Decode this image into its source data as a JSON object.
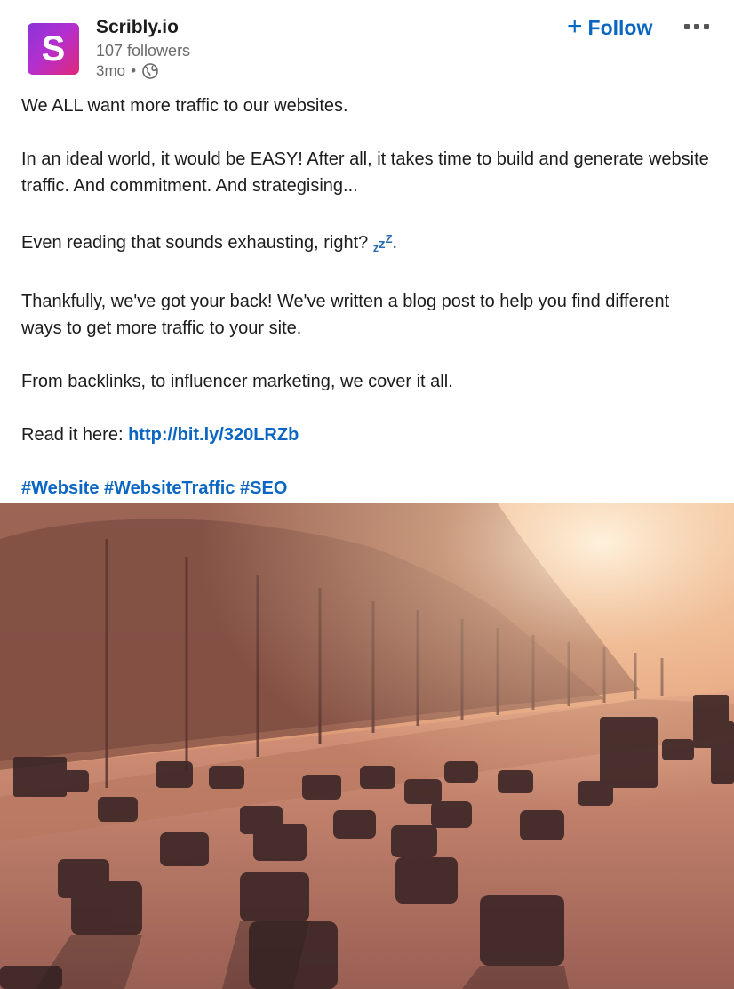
{
  "author": {
    "logo_letter": "S",
    "name": "Scribly.io",
    "followers": "107 followers",
    "time": "3mo",
    "separator": "•",
    "visibility_icon": "globe-icon"
  },
  "actions": {
    "follow_plus": "+",
    "follow_label": "Follow",
    "more_icon": "ellipsis-icon"
  },
  "post": {
    "p1": "We ALL want more traffic to our websites.",
    "p2": "In an ideal world, it would be EASY! After all, it takes time to build and generate website traffic. And commitment. And strategising...",
    "p3_text": "Even reading that sounds exhausting, right? ",
    "p3_emoji_small": "z",
    "p3_emoji_mid": "z",
    "p3_emoji_big": "Z",
    "p3_end": ".",
    "p4": "Thankfully, we've got your back! We've written a blog post to help you find different ways to get more traffic to your site.",
    "p5": "From backlinks, to influencer marketing, we cover it all.",
    "p6_prefix": "Read it here: ",
    "link": "http://bit.ly/320LRZb",
    "hashtags": [
      "#Website",
      "#WebsiteTraffic",
      "#SEO"
    ]
  },
  "colors": {
    "link": "#0a66c2",
    "logo_gradient": [
      "#8a35d8",
      "#e0287a"
    ]
  }
}
